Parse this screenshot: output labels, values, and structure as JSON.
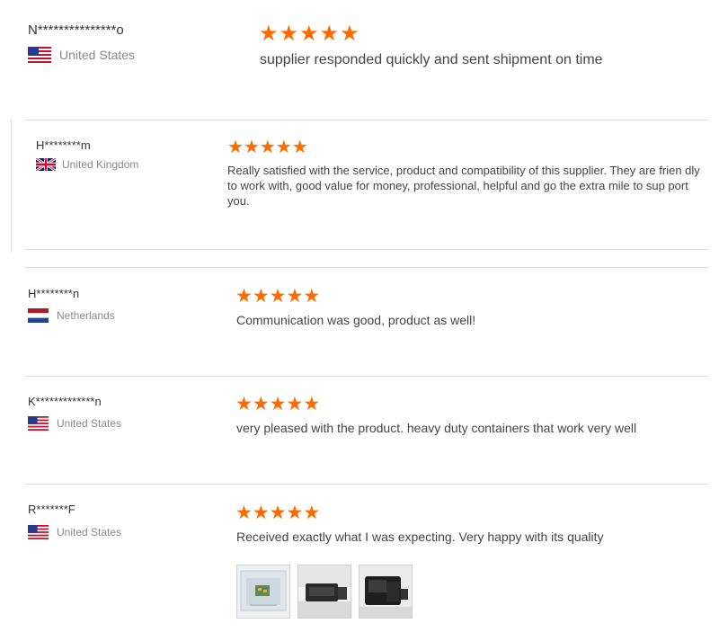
{
  "reviews": [
    {
      "name": "N***************o",
      "country": "United States",
      "flag": "us-flag-icon",
      "rating": 5,
      "comment": "supplier responded quickly and sent shipment on time"
    },
    {
      "name": "H********m",
      "country": "United Kingdom",
      "flag": "uk-flag-icon",
      "rating": 5,
      "comment": "Really satisfied with the service, product and compatibility of this supplier. They are frien dly to work with, good value for money, professional, helpful and go the extra mile to sup port you."
    },
    {
      "name": "H********n",
      "country": "Netherlands",
      "flag": "nl-flag-icon",
      "rating": 5,
      "comment": "Communication was good, product as well!"
    },
    {
      "name": "K*************n",
      "country": "United States",
      "flag": "us-flag-icon",
      "rating": 5,
      "comment": "very pleased with the product. heavy duty containers that work very well"
    },
    {
      "name": "R*******F",
      "country": "United States",
      "flag": "us-flag-icon",
      "rating": 5,
      "comment": "Received exactly what I was expecting. Very happy with its quality"
    }
  ],
  "colors": {
    "star": "#ff6a00",
    "divider": "#dcdcdc",
    "country_text": "#888888"
  }
}
